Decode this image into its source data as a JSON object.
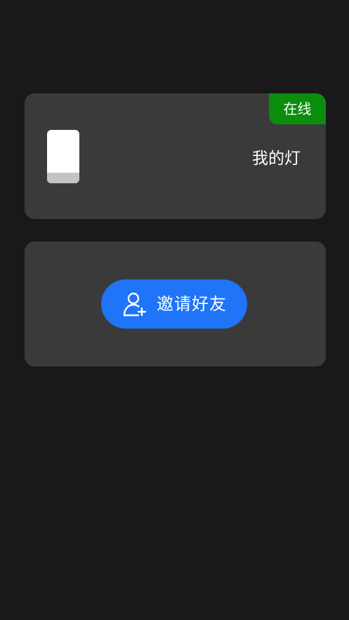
{
  "device": {
    "status": "在线",
    "name": "我的灯",
    "status_color": "#0b8e0b",
    "icon": "lamp-icon"
  },
  "invite": {
    "label": "邀请好友",
    "icon": "add-user-icon",
    "button_color": "#1f74f8"
  }
}
